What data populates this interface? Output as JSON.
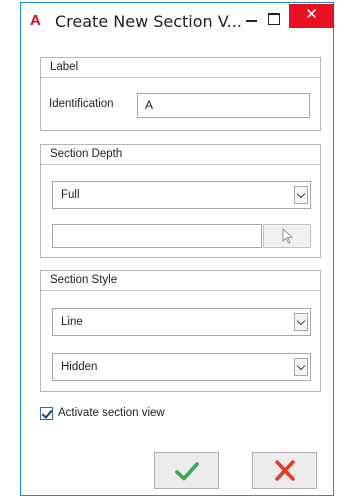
{
  "window": {
    "title": "Create New Section V...",
    "app_icon_letter": "A",
    "close_glyph": "✕"
  },
  "label_group": {
    "header": "Label",
    "identification_label": "Identification",
    "identification_value": "A"
  },
  "depth_group": {
    "header": "Section Depth",
    "depth_selected": "Full",
    "depth_text_value": "",
    "pick_icon": "cursor-arrow-icon"
  },
  "style_group": {
    "header": "Section Style",
    "style_selected": "Line",
    "line_type_selected": "Hidden"
  },
  "options": {
    "activate_label": "Activate section view",
    "activate_checked": true
  },
  "actions": {
    "ok_icon": "checkmark-icon",
    "cancel_icon": "x-icon"
  },
  "colors": {
    "accent_border": "#1f8fd6",
    "close_red": "#e81123",
    "ok_green": "#35a85c",
    "cancel_red": "#e33c2b",
    "app_icon_red": "#c8102e"
  }
}
